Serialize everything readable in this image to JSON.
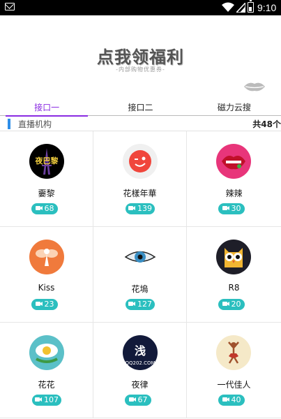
{
  "status_bar": {
    "time": "9:10",
    "icons": [
      "mail-icon",
      "wifi-icon",
      "signal-icon",
      "battery-icon"
    ]
  },
  "banner": {
    "title": "点我领福利",
    "subtitle": "-内部购物优惠券-"
  },
  "tabs": [
    {
      "label": "接口一",
      "active": true
    },
    {
      "label": "接口二",
      "active": false
    },
    {
      "label": "磁力云搜",
      "active": false
    }
  ],
  "section": {
    "label": "直播机构",
    "count": "共48个"
  },
  "colors": {
    "accent": "#8a2be2",
    "badge": "#2bbfbf",
    "section_bar": "#2e8ee8"
  },
  "platforms": [
    {
      "name": "嫑黎",
      "count": "68",
      "icon": "paris-eiffel-icon"
    },
    {
      "name": "花樣年華",
      "count": "139",
      "icon": "wink-face-icon"
    },
    {
      "name": "辣辣",
      "count": "30",
      "icon": "lips-icon"
    },
    {
      "name": "Kiss",
      "count": "23",
      "icon": "fairy-icon"
    },
    {
      "name": "花塢",
      "count": "127",
      "icon": "eye-icon"
    },
    {
      "name": "R8",
      "count": "20",
      "icon": "owl-icon"
    },
    {
      "name": "花花",
      "count": "107",
      "icon": "flower-icon"
    },
    {
      "name": "夜律",
      "count": "67",
      "icon": "shallow-text-icon"
    },
    {
      "name": "一代佳人",
      "count": "40",
      "icon": "dancer-icon"
    }
  ]
}
